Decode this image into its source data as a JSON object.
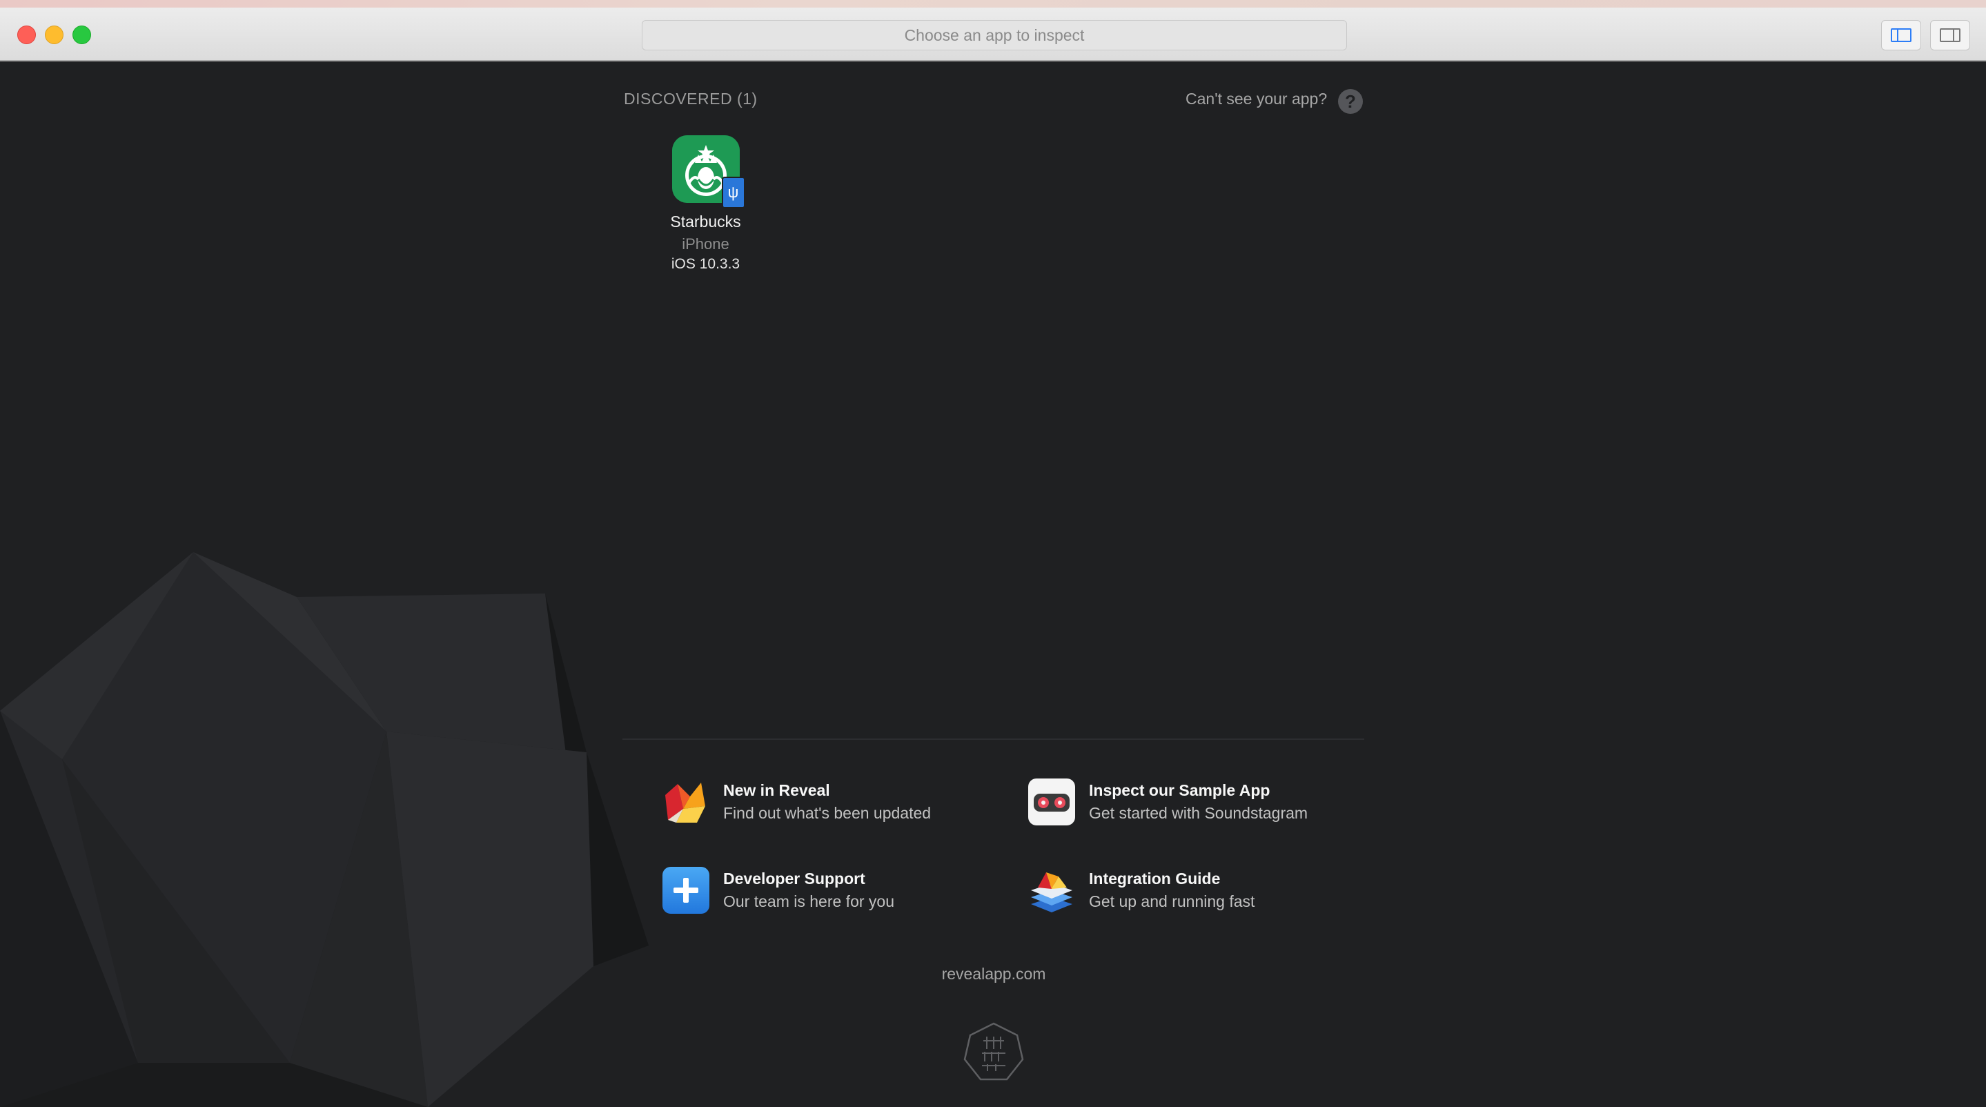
{
  "window": {
    "app_chooser_placeholder": "Choose an app to inspect"
  },
  "discovered": {
    "title": "DISCOVERED (1)",
    "help_text": "Can't see your app?",
    "help_icon_glyph": "?",
    "apps": [
      {
        "name": "Starbucks",
        "device": "iPhone",
        "os": "iOS 10.3.3",
        "icon": "starbucks-logo-icon",
        "badge": "usb-connection-icon"
      }
    ]
  },
  "links": [
    {
      "title": "New in Reveal",
      "subtitle": "Find out what's been updated",
      "icon": "reveal-origami-icon"
    },
    {
      "title": "Inspect our Sample App",
      "subtitle": "Get started with Soundstagram",
      "icon": "soundstagram-icon"
    },
    {
      "title": "Developer Support",
      "subtitle": "Our team is here for you",
      "icon": "plus-icon"
    },
    {
      "title": "Integration Guide",
      "subtitle": "Get up and running fast",
      "icon": "stacked-layers-icon"
    }
  ],
  "footer": {
    "site": "revealapp.com",
    "logo": "itty-bitty-apps-logo"
  },
  "colors": {
    "background": "#1f2022",
    "starbucks_green": "#1e9a54",
    "usb_badge": "#2a77d9",
    "support_blue": "#2f8fe8"
  }
}
